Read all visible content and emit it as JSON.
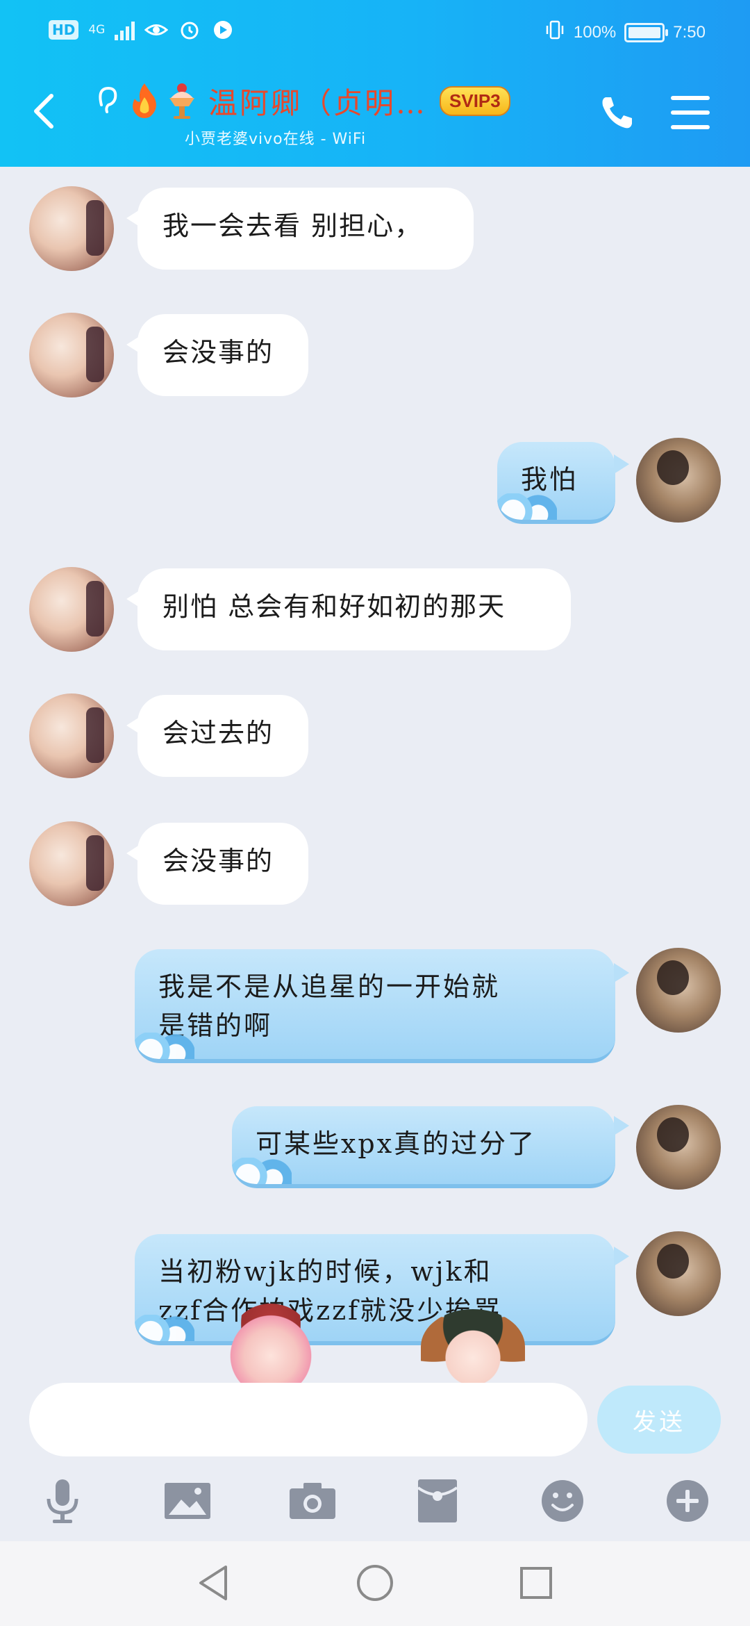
{
  "status_bar": {
    "hd": "HD",
    "network": "4G",
    "battery": "100%",
    "time": "7:50"
  },
  "header": {
    "chat_name": "温阿卿（贞明…",
    "vip_badge": "SVIP3",
    "subtitle": "小贾老婆vivo在线 - WiFi"
  },
  "messages": [
    {
      "side": "left",
      "text": "我一会去看 别担心，"
    },
    {
      "side": "left",
      "text": "会没事的"
    },
    {
      "side": "right",
      "text": "我怕"
    },
    {
      "side": "left",
      "text": "别怕 总会有和好如初的那天"
    },
    {
      "side": "left",
      "text": "会过去的"
    },
    {
      "side": "left",
      "text": "会没事的"
    },
    {
      "side": "right",
      "line1": "我是不是从追星的一开始就",
      "line2": "是错的啊"
    },
    {
      "side": "right",
      "text": "可某些xpx真的过分了"
    },
    {
      "side": "right",
      "line1": "当初粉wjk的时候，wjk和",
      "line2": "zzf合作拍戏zzf就没少挨骂"
    }
  ],
  "input": {
    "placeholder": "",
    "send_label": "发送"
  },
  "toolbar": [
    "mic-icon",
    "image-icon",
    "camera-icon",
    "red-packet-icon",
    "emoji-icon",
    "plus-icon"
  ],
  "colors": {
    "header_start": "#12c2f5",
    "header_end": "#1e9bf3",
    "name": "#e8482b",
    "bubble_right": "#b8e0f9",
    "send_disabled": "#bfe9fb"
  }
}
